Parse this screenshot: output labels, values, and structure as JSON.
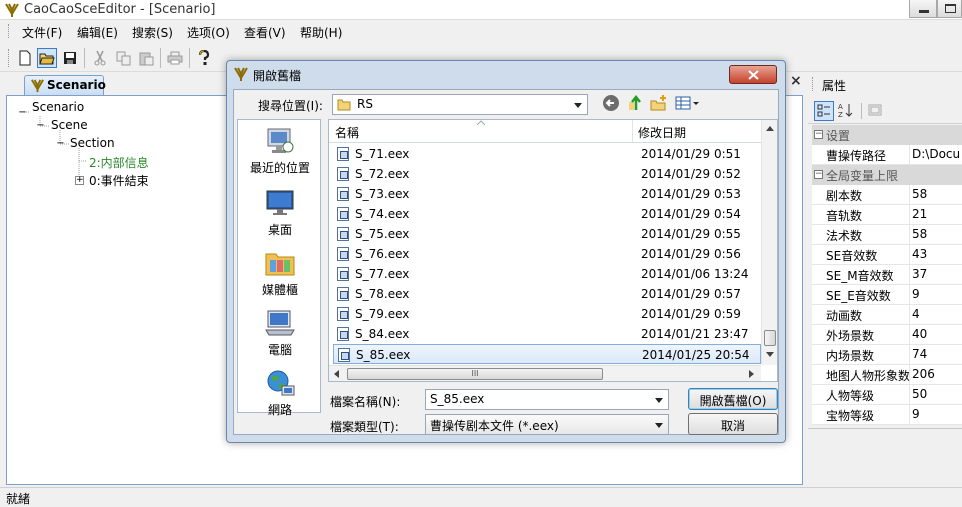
{
  "app": {
    "title": "CaoCaoSceEditor - [Scenario]",
    "menu": [
      "文件(F)",
      "编辑(E)",
      "搜索(S)",
      "选项(O)",
      "查看(V)",
      "帮助(H)"
    ],
    "doc_tab": "Scenario",
    "tree": {
      "root": "Scenario",
      "scene": "Scene",
      "section": "Section",
      "child1": "2:内部信息",
      "child2": "0:事件結束"
    },
    "status": "就緒",
    "close_glyph": "×"
  },
  "properties": {
    "title": "属性",
    "categories": [
      "设置",
      "全局变量上限"
    ],
    "settings": [
      {
        "key": "曹操传路径",
        "value": "D:\\Docu"
      }
    ],
    "limits": [
      {
        "key": "剧本数",
        "value": "58"
      },
      {
        "key": "音轨数",
        "value": "21"
      },
      {
        "key": "法术数",
        "value": "58"
      },
      {
        "key": "SE音效数",
        "value": "43"
      },
      {
        "key": "SE_M音效数",
        "value": "37"
      },
      {
        "key": "SE_E音效数",
        "value": "9"
      },
      {
        "key": "动画数",
        "value": "4"
      },
      {
        "key": "外场景数",
        "value": "40"
      },
      {
        "key": "内场景数",
        "value": "74"
      },
      {
        "key": "地图人物形象数",
        "value": "206"
      },
      {
        "key": "人物等级",
        "value": "50"
      },
      {
        "key": "宝物等级",
        "value": "9"
      }
    ]
  },
  "dialog": {
    "title": "開啟舊檔",
    "look_in_label": "搜尋位置(I):",
    "look_in_value": "RS",
    "places": [
      "最近的位置",
      "桌面",
      "媒體櫃",
      "電腦",
      "網路"
    ],
    "columns": {
      "name": "名稱",
      "date": "修改日期"
    },
    "files": [
      {
        "name": "S_71.eex",
        "date": "2014/01/29 0:51"
      },
      {
        "name": "S_72.eex",
        "date": "2014/01/29 0:52"
      },
      {
        "name": "S_73.eex",
        "date": "2014/01/29 0:53"
      },
      {
        "name": "S_74.eex",
        "date": "2014/01/29 0:54"
      },
      {
        "name": "S_75.eex",
        "date": "2014/01/29 0:55"
      },
      {
        "name": "S_76.eex",
        "date": "2014/01/29 0:56"
      },
      {
        "name": "S_77.eex",
        "date": "2014/01/06 13:24"
      },
      {
        "name": "S_78.eex",
        "date": "2014/01/29 0:57"
      },
      {
        "name": "S_79.eex",
        "date": "2014/01/29 0:59"
      },
      {
        "name": "S_84.eex",
        "date": "2014/01/21 23:47"
      },
      {
        "name": "S_85.eex",
        "date": "2014/01/25 20:54"
      }
    ],
    "filename_label": "檔案名稱(N):",
    "filename_value": "S_85.eex",
    "filetype_label": "檔案類型(T):",
    "filetype_value": "曹操传剧本文件 (*.eex)",
    "open_button": "開啟舊檔(O)",
    "cancel_button": "取消",
    "hscroll_grip": "III"
  }
}
